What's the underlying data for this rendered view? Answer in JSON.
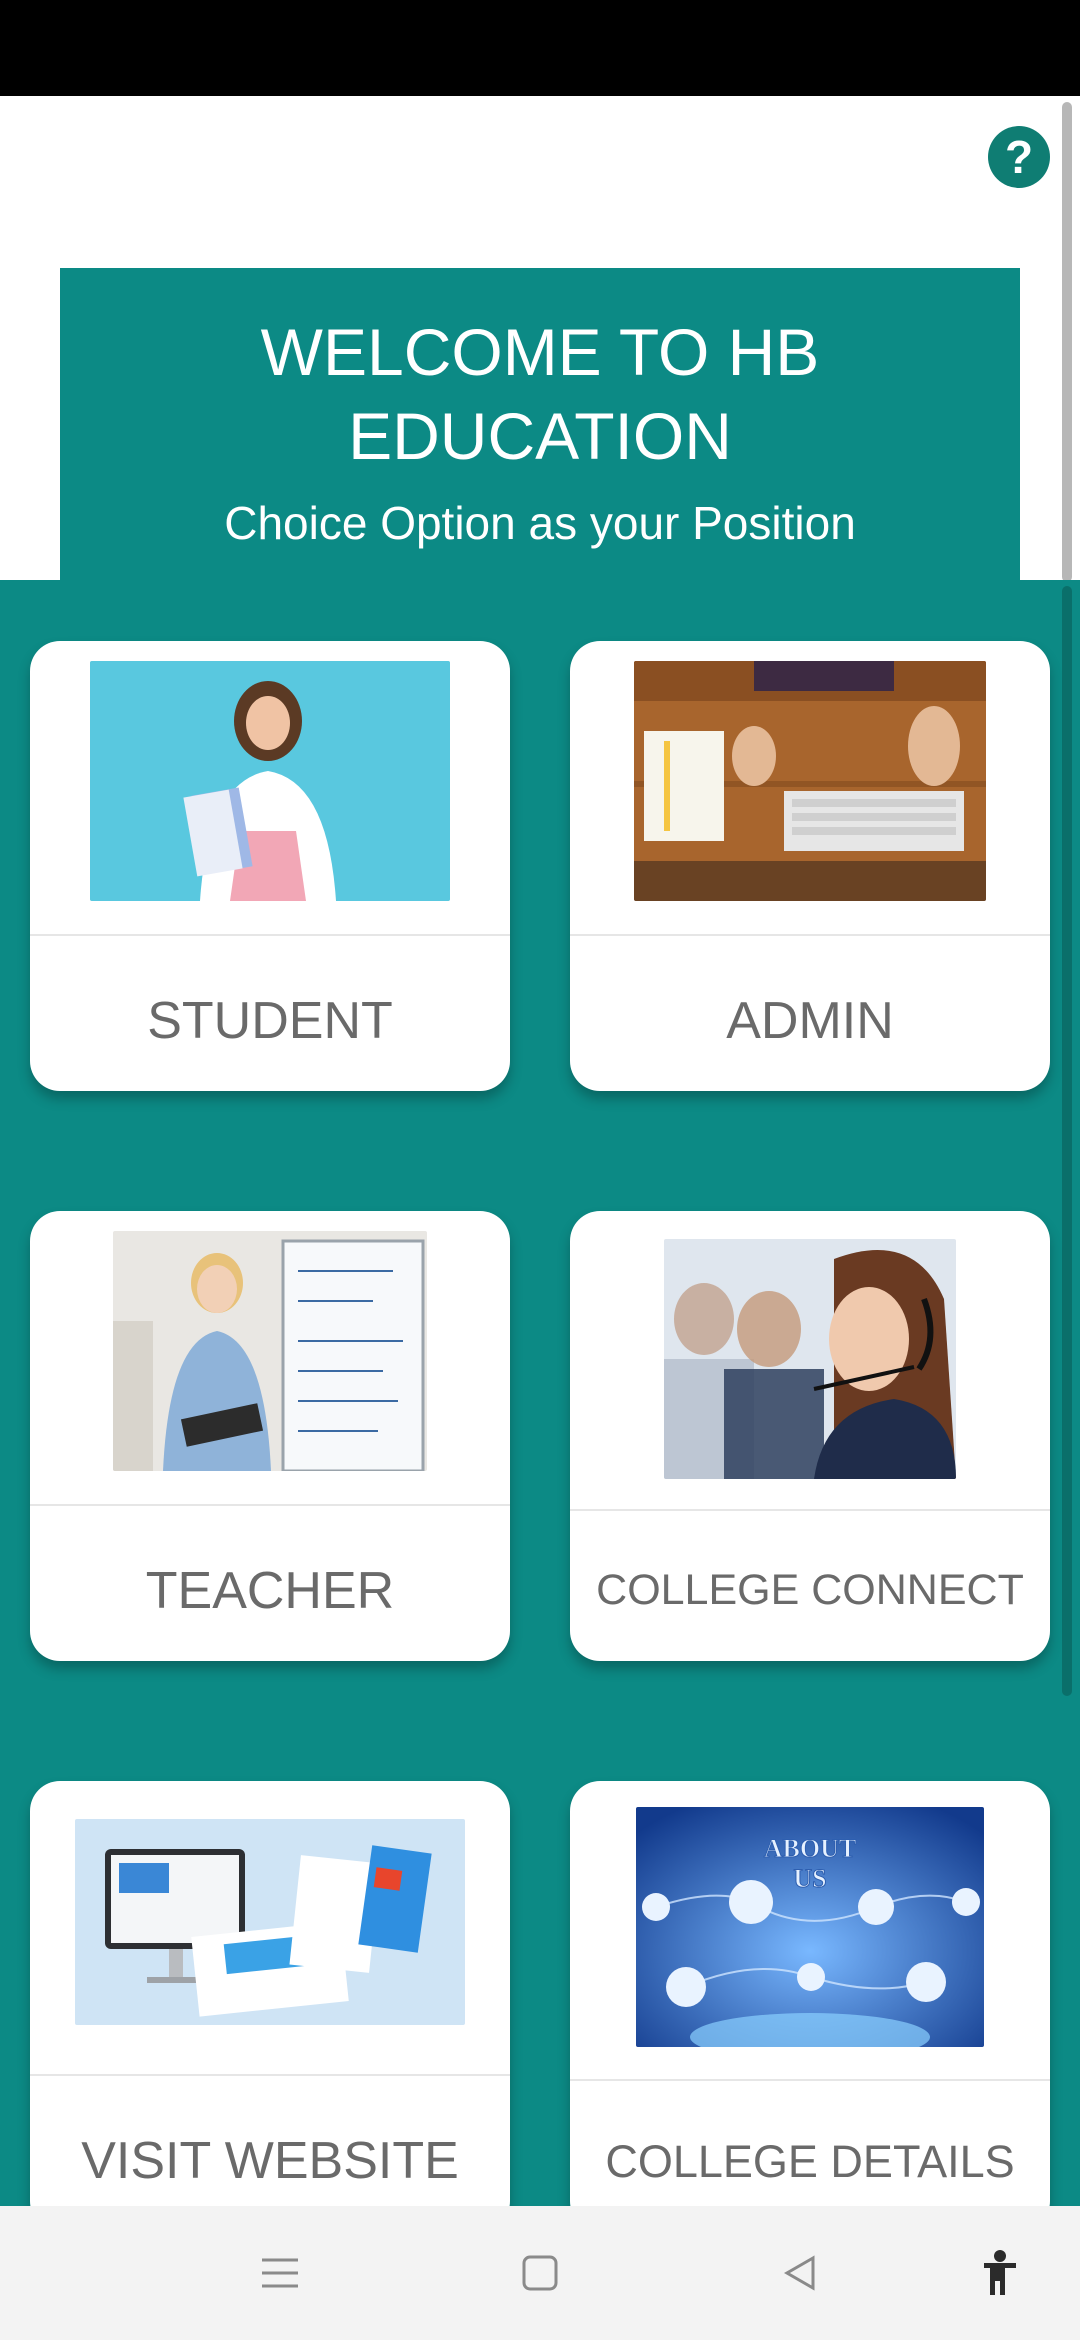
{
  "header": {
    "title": "WELCOME TO HB EDUCATION",
    "subtitle": "Choice Option as your Position"
  },
  "help_icon": "?",
  "cards": [
    {
      "label": "STUDENT",
      "image": "student-photo"
    },
    {
      "label": "ADMIN",
      "image": "admin-desk-photo"
    },
    {
      "label": "TEACHER",
      "image": "teacher-photo"
    },
    {
      "label": "COLLEGE CONNECT",
      "image": "call-center-photo"
    },
    {
      "label": "VISIT WEBSITE",
      "image": "website-devices-photo"
    },
    {
      "label": "COLLEGE  DETAILS",
      "image": "about-us-photo",
      "image_text": [
        "ABOUT",
        "US"
      ]
    }
  ],
  "nav": {
    "items": [
      "menu-icon",
      "home-square-icon",
      "back-triangle-icon",
      "accessibility-icon"
    ]
  },
  "colors": {
    "teal": "#0c8a85",
    "card": "#ffffff",
    "label": "#6a6a6a"
  }
}
